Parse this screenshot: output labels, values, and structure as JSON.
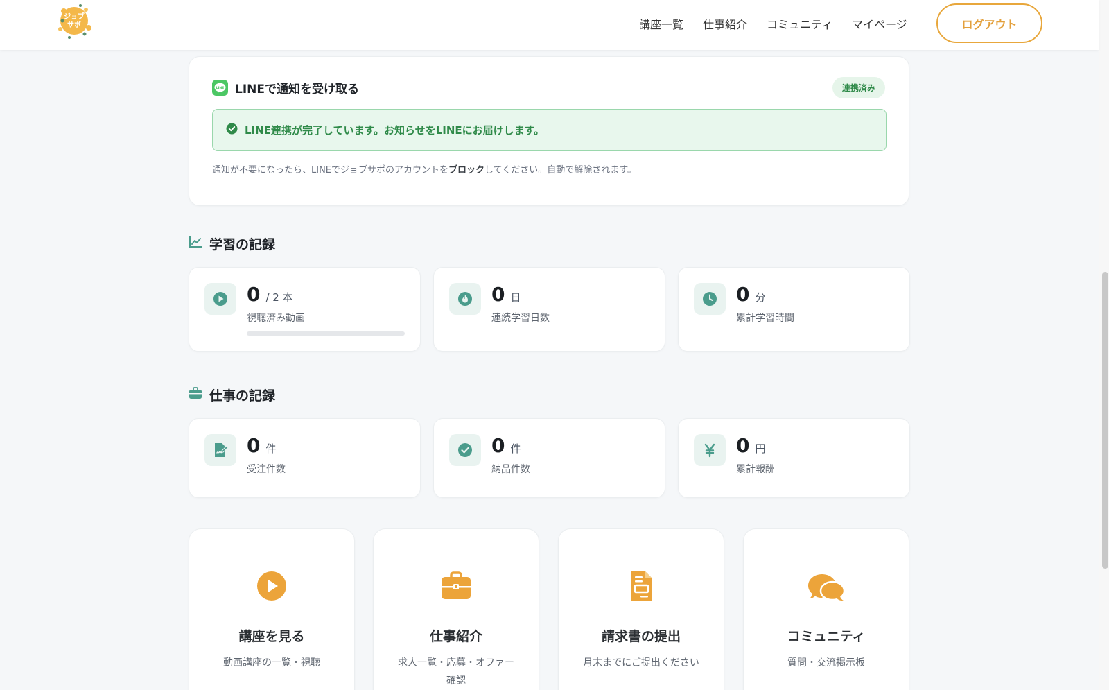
{
  "header": {
    "logo_text": "ジョブサポ",
    "nav": [
      "講座一覧",
      "仕事紹介",
      "コミュニティ",
      "マイページ"
    ],
    "logout_label": "ログアウト"
  },
  "line_card": {
    "title": "LINEで通知を受け取る",
    "logo_text": "LINE",
    "status_badge": "連携済み",
    "success_message": "LINE連携が完了しています。お知らせをLINEにお届けします。",
    "note_before": "通知が不要になったら、LINEでジョブサポのアカウントを",
    "note_bold": "ブロック",
    "note_after": "してください。自動で解除されます。"
  },
  "learning": {
    "title": "学習の記録",
    "stats": [
      {
        "icon": "play-icon",
        "value": "0",
        "unit": "/ 2 本",
        "label": "視聴済み動画",
        "progress": 0
      },
      {
        "icon": "flame-icon",
        "value": "0",
        "unit": "日",
        "label": "連続学習日数"
      },
      {
        "icon": "clock-icon",
        "value": "0",
        "unit": "分",
        "label": "累計学習時間"
      }
    ]
  },
  "work": {
    "title": "仕事の記録",
    "stats": [
      {
        "icon": "contract-icon",
        "value": "0",
        "unit": "件",
        "label": "受注件数"
      },
      {
        "icon": "check-circle-icon",
        "value": "0",
        "unit": "件",
        "label": "納品件数"
      },
      {
        "icon": "yen-icon",
        "value": "0",
        "unit": "円",
        "label": "累計報酬"
      }
    ]
  },
  "actions": [
    {
      "icon": "play-circle-icon",
      "title": "講座を見る",
      "desc": "動画講座の一覧・視聴"
    },
    {
      "icon": "briefcase-icon",
      "title": "仕事紹介",
      "desc": "求人一覧・応募・オファー確認"
    },
    {
      "icon": "invoice-icon",
      "title": "請求書の提出",
      "desc": "月末までにご提出ください"
    },
    {
      "icon": "chat-bubbles-icon",
      "title": "コミュニティ",
      "desc": "質問・交流掲示板"
    }
  ],
  "colors": {
    "accent": "#e8a73c",
    "teal": "#4a9c8c",
    "line_green": "#4cc764",
    "success_text": "#2f8a49"
  }
}
